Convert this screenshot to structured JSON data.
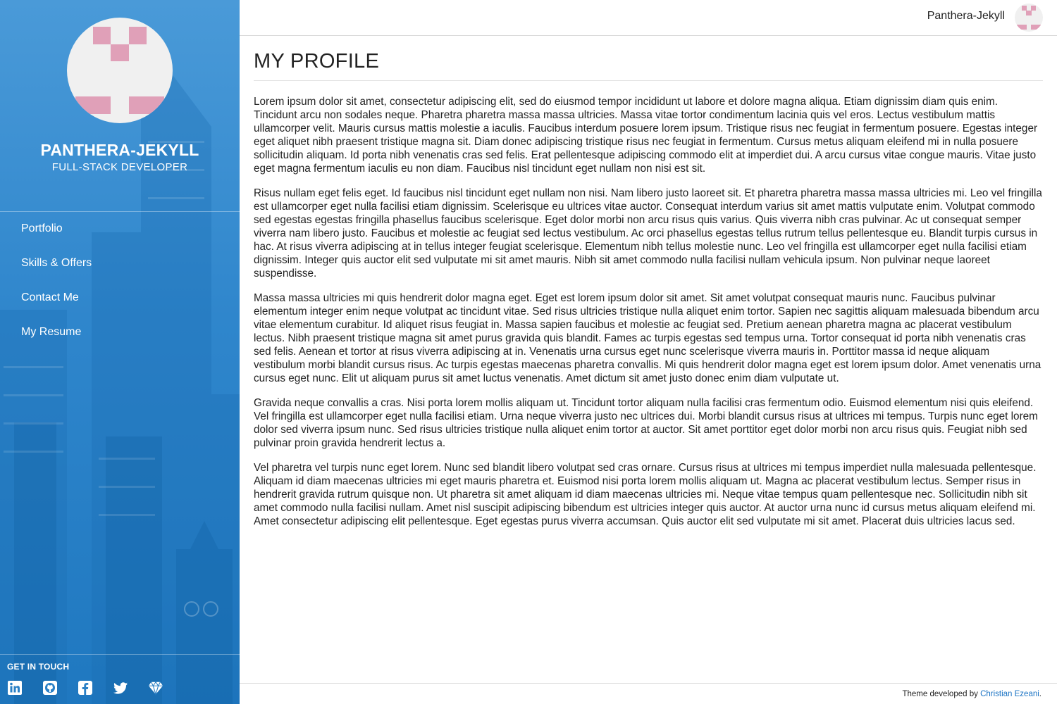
{
  "header": {
    "user_name": "Panthera-Jekyll",
    "avatar_icon": "identicon-avatar"
  },
  "sidebar": {
    "site_name": "PANTHERA-JEKYLL",
    "site_role": "FULL-STACK DEVELOPER",
    "nav": [
      {
        "label": "Portfolio"
      },
      {
        "label": "Skills & Offers"
      },
      {
        "label": "Contact Me"
      },
      {
        "label": "My Resume"
      }
    ],
    "get_in_touch": "GET IN TOUCH",
    "socials": [
      "linkedin-icon",
      "github-icon",
      "facebook-icon",
      "twitter-icon",
      "gem-icon"
    ],
    "accent": "#2f86cc"
  },
  "main": {
    "title": "MY PROFILE",
    "paragraphs": [
      "Lorem ipsum dolor sit amet, consectetur adipiscing elit, sed do eiusmod tempor incididunt ut labore et dolore magna aliqua. Etiam dignissim diam quis enim. Tincidunt arcu non sodales neque. Pharetra pharetra massa massa ultricies. Massa vitae tortor condimentum lacinia quis vel eros. Lectus vestibulum mattis ullamcorper velit. Mauris cursus mattis molestie a iaculis. Faucibus interdum posuere lorem ipsum. Tristique risus nec feugiat in fermentum posuere. Egestas integer eget aliquet nibh praesent tristique magna sit. Diam donec adipiscing tristique risus nec feugiat in fermentum. Cursus metus aliquam eleifend mi in nulla posuere sollicitudin aliquam. Id porta nibh venenatis cras sed felis. Erat pellentesque adipiscing commodo elit at imperdiet dui. A arcu cursus vitae congue mauris. Vitae justo eget magna fermentum iaculis eu non diam. Faucibus nisl tincidunt eget nullam non nisi est sit.",
      "Risus nullam eget felis eget. Id faucibus nisl tincidunt eget nullam non nisi. Nam libero justo laoreet sit. Et pharetra pharetra massa massa ultricies mi. Leo vel fringilla est ullamcorper eget nulla facilisi etiam dignissim. Scelerisque eu ultrices vitae auctor. Consequat interdum varius sit amet mattis vulputate enim. Volutpat commodo sed egestas egestas fringilla phasellus faucibus scelerisque. Eget dolor morbi non arcu risus quis varius. Quis viverra nibh cras pulvinar. Ac ut consequat semper viverra nam libero justo. Faucibus et molestie ac feugiat sed lectus vestibulum. Ac orci phasellus egestas tellus rutrum tellus pellentesque eu. Blandit turpis cursus in hac. At risus viverra adipiscing at in tellus integer feugiat scelerisque. Elementum nibh tellus molestie nunc. Leo vel fringilla est ullamcorper eget nulla facilisi etiam dignissim. Integer quis auctor elit sed vulputate mi sit amet mauris. Nibh sit amet commodo nulla facilisi nullam vehicula ipsum. Non pulvinar neque laoreet suspendisse.",
      "Massa massa ultricies mi quis hendrerit dolor magna eget. Eget est lorem ipsum dolor sit amet. Sit amet volutpat consequat mauris nunc. Faucibus pulvinar elementum integer enim neque volutpat ac tincidunt vitae. Sed risus ultricies tristique nulla aliquet enim tortor. Sapien nec sagittis aliquam malesuada bibendum arcu vitae elementum curabitur. Id aliquet risus feugiat in. Massa sapien faucibus et molestie ac feugiat sed. Pretium aenean pharetra magna ac placerat vestibulum lectus. Nibh praesent tristique magna sit amet purus gravida quis blandit. Fames ac turpis egestas sed tempus urna. Tortor consequat id porta nibh venenatis cras sed felis. Aenean et tortor at risus viverra adipiscing at in. Venenatis urna cursus eget nunc scelerisque viverra mauris in. Porttitor massa id neque aliquam vestibulum morbi blandit cursus risus. Ac turpis egestas maecenas pharetra convallis. Mi quis hendrerit dolor magna eget est lorem ipsum dolor. Amet venenatis urna cursus eget nunc. Elit ut aliquam purus sit amet luctus venenatis. Amet dictum sit amet justo donec enim diam vulputate ut.",
      "Gravida neque convallis a cras. Nisi porta lorem mollis aliquam ut. Tincidunt tortor aliquam nulla facilisi cras fermentum odio. Euismod elementum nisi quis eleifend. Vel fringilla est ullamcorper eget nulla facilisi etiam. Urna neque viverra justo nec ultrices dui. Morbi blandit cursus risus at ultrices mi tempus. Turpis nunc eget lorem dolor sed viverra ipsum nunc. Sed risus ultricies tristique nulla aliquet enim tortor at auctor. Sit amet porttitor eget dolor morbi non arcu risus quis. Feugiat nibh sed pulvinar proin gravida hendrerit lectus a.",
      "Vel pharetra vel turpis nunc eget lorem. Nunc sed blandit libero volutpat sed cras ornare. Cursus risus at ultrices mi tempus imperdiet nulla malesuada pellentesque. Aliquam id diam maecenas ultricies mi eget mauris pharetra et. Euismod nisi porta lorem mollis aliquam ut. Magna ac placerat vestibulum lectus. Semper risus in hendrerit gravida rutrum quisque non. Ut pharetra sit amet aliquam id diam maecenas ultricies mi. Neque vitae tempus quam pellentesque nec. Sollicitudin nibh sit amet commodo nulla facilisi nullam. Amet nisl suscipit adipiscing bibendum est ultricies integer quis auctor. At auctor urna nunc id cursus metus aliquam eleifend mi. Amet consectetur adipiscing elit pellentesque. Eget egestas purus viverra accumsan. Quis auctor elit sed vulputate mi sit amet. Placerat duis ultricies lacus sed."
    ]
  },
  "footer": {
    "prefix": "Theme developed by ",
    "author": "Christian Ezeani",
    "suffix": ".",
    "link_color": "#1a73c4"
  }
}
